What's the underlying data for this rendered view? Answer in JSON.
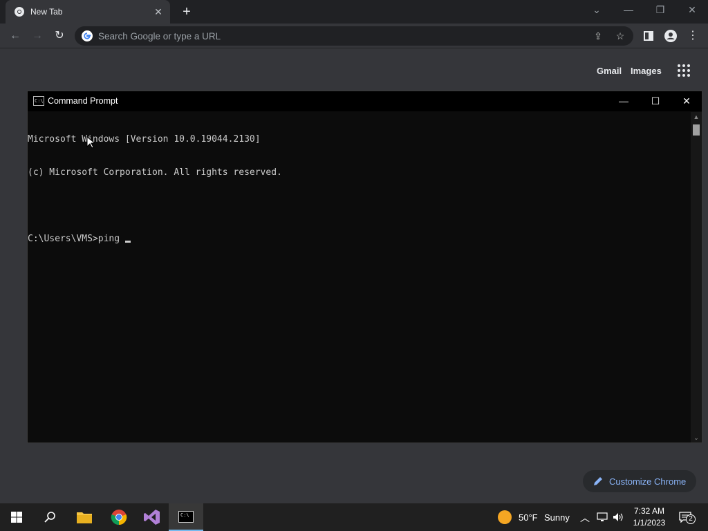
{
  "browser": {
    "tab": {
      "title": "New Tab"
    },
    "omnibox": {
      "placeholder": "Search Google or type a URL"
    },
    "ntp": {
      "gmail": "Gmail",
      "images": "Images",
      "customize_label": "Customize Chrome"
    },
    "colors": {
      "link_accent": "#8ab4f8",
      "frame": "#202124",
      "toolbar": "#35363a"
    }
  },
  "cmd": {
    "title": "Command Prompt",
    "lines": [
      "Microsoft Windows [Version 10.0.19044.2130]",
      "(c) Microsoft Corporation. All rights reserved.",
      "",
      "C:\\Users\\VMS>ping"
    ]
  },
  "taskbar": {
    "weather": {
      "temp": "50°F",
      "condition": "Sunny"
    },
    "clock": {
      "time": "7:32 AM",
      "date": "1/1/2023"
    },
    "notification_count": "2",
    "apps": [
      "start-icon",
      "search-icon",
      "file-explorer-icon",
      "chrome-icon",
      "visual-studio-icon",
      "command-prompt-icon"
    ]
  }
}
